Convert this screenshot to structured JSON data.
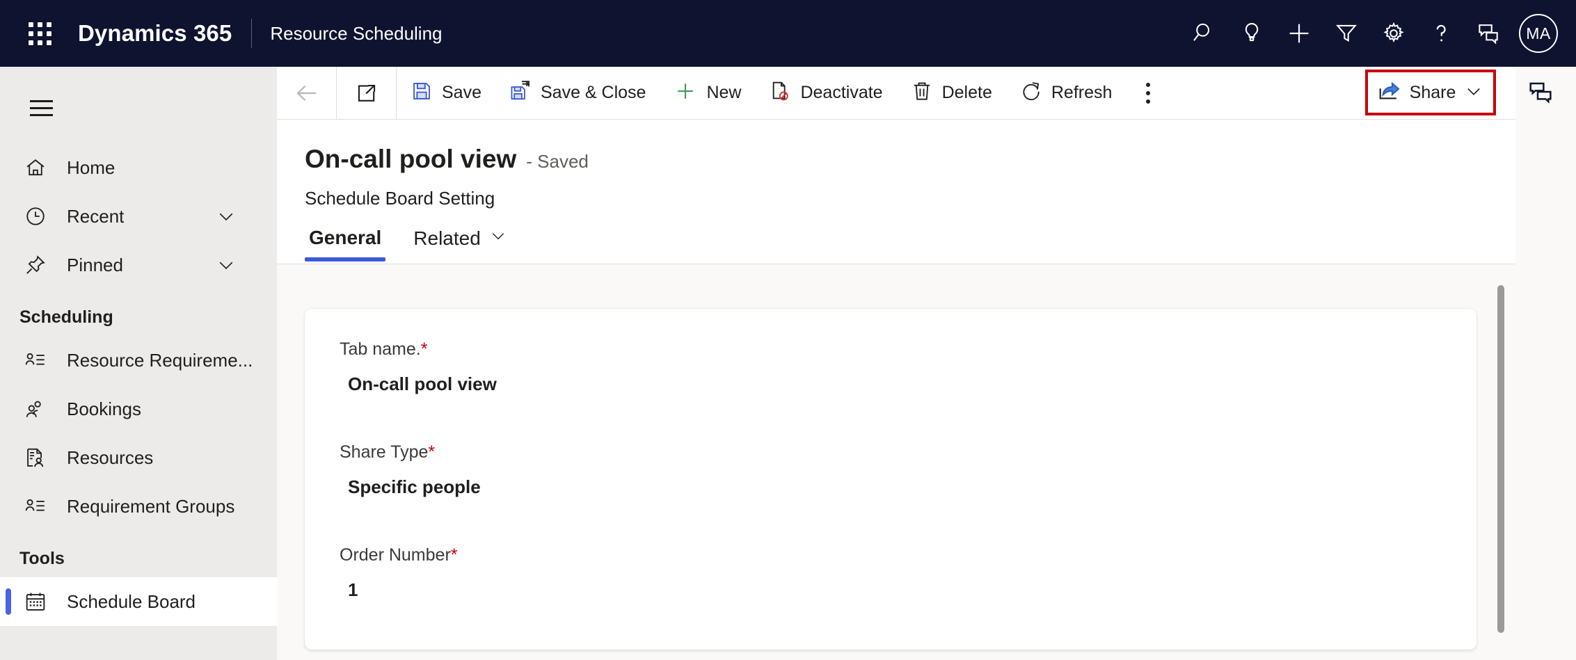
{
  "topbar": {
    "waffle_label": "app-launcher",
    "brand": "Dynamics 365",
    "app_name": "Resource Scheduling",
    "actions": [
      {
        "name": "search-icon",
        "label": "Search"
      },
      {
        "name": "lightbulb-icon",
        "label": "Insights"
      },
      {
        "name": "plus-icon",
        "label": "Quick create"
      },
      {
        "name": "filter-icon",
        "label": "Filter"
      },
      {
        "name": "gear-icon",
        "label": "Settings"
      },
      {
        "name": "question-icon",
        "label": "Help"
      },
      {
        "name": "feedback-icon",
        "label": "Feedback"
      }
    ],
    "avatar_initials": "MA"
  },
  "sidebar": {
    "hamburger_label": "Expand navigation",
    "items": [
      {
        "label": "Home",
        "icon": "home-icon",
        "chevron": false,
        "selected": false
      },
      {
        "label": "Recent",
        "icon": "clock-icon",
        "chevron": true,
        "selected": false
      },
      {
        "label": "Pinned",
        "icon": "pin-icon",
        "chevron": true,
        "selected": false
      }
    ],
    "groups": [
      {
        "title": "Scheduling",
        "items": [
          {
            "label": "Resource Requireme...",
            "icon": "resource-requirements-icon",
            "selected": false
          },
          {
            "label": "Bookings",
            "icon": "bookings-icon",
            "selected": false
          },
          {
            "label": "Resources",
            "icon": "resources-icon",
            "selected": false
          },
          {
            "label": "Requirement Groups",
            "icon": "requirement-groups-icon",
            "selected": false
          }
        ]
      },
      {
        "title": "Tools",
        "items": [
          {
            "label": "Schedule Board",
            "icon": "calendar-icon",
            "selected": true
          }
        ]
      }
    ]
  },
  "commandbar": {
    "back_label": "Back",
    "popout_label": "Open in new window",
    "buttons": [
      {
        "label": "Save",
        "icon": "save-icon"
      },
      {
        "label": "Save & Close",
        "icon": "save-close-icon"
      },
      {
        "label": "New",
        "icon": "plus-icon"
      },
      {
        "label": "Deactivate",
        "icon": "deactivate-icon"
      },
      {
        "label": "Delete",
        "icon": "trash-icon"
      },
      {
        "label": "Refresh",
        "icon": "refresh-icon"
      }
    ],
    "overflow_label": "More commands",
    "share": {
      "label": "Share",
      "icon": "share-icon",
      "chevron": "chevron-down-icon",
      "highlight_color": "#C8000B"
    },
    "chat_label": "Chat"
  },
  "record": {
    "title": "On-call pool view",
    "state": "- Saved",
    "entity": "Schedule Board Setting",
    "tabs": [
      {
        "label": "General",
        "active": true,
        "chevron": false
      },
      {
        "label": "Related",
        "active": false,
        "chevron": true
      }
    ]
  },
  "form": {
    "fields": [
      {
        "label": "Tab name.",
        "required": true,
        "value": "On-call pool view"
      },
      {
        "label": "Share Type",
        "required": true,
        "value": "Specific people"
      },
      {
        "label": "Order Number",
        "required": true,
        "value": "1"
      }
    ]
  },
  "colors": {
    "brand_navy": "#0E1330",
    "accent_blue": "#3B5BD6",
    "nav_selected_bar": "#4B63E0",
    "required_red": "#C8000B",
    "sidebar_bg": "#EDEBE9",
    "content_bg": "#FAF9F8"
  },
  "scrollbar": {
    "name": "vertical-scrollbar"
  }
}
